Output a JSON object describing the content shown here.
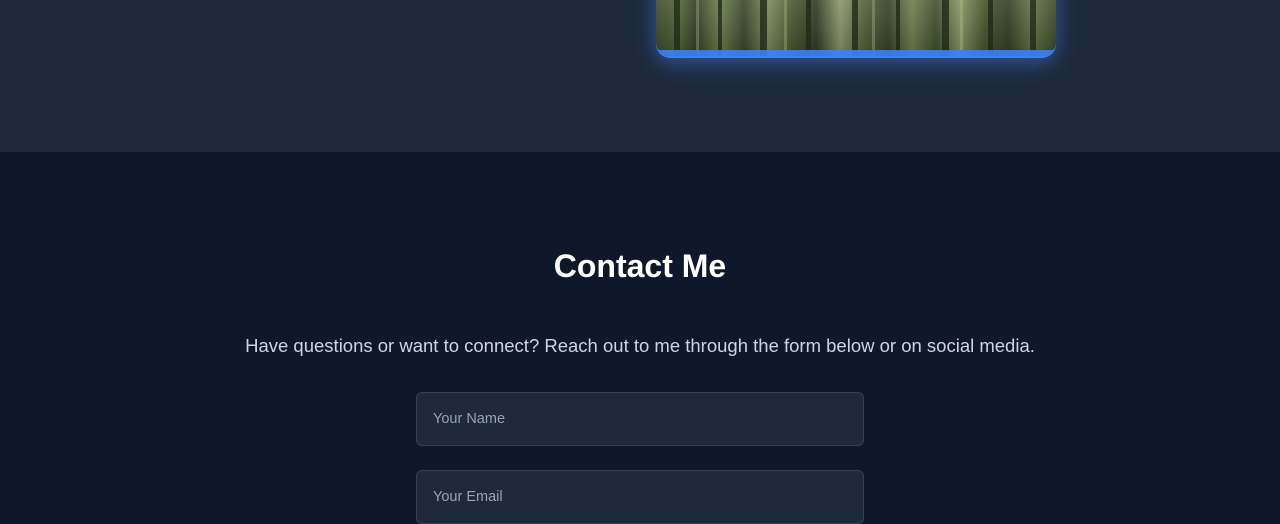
{
  "hero": {
    "image_alt": "forest-landscape-photo",
    "glow_color": "#3b82f6"
  },
  "contact": {
    "title": "Contact Me",
    "description": "Have questions or want to connect? Reach out to me through the form below or on social media.",
    "name_field": {
      "placeholder": "Your Name",
      "value": ""
    },
    "email_field": {
      "placeholder": "Your Email",
      "value": ""
    }
  },
  "colors": {
    "top_background": "#1e293b",
    "page_background": "#0f172a",
    "input_background": "#1e293b",
    "accent": "#3b82f6"
  }
}
